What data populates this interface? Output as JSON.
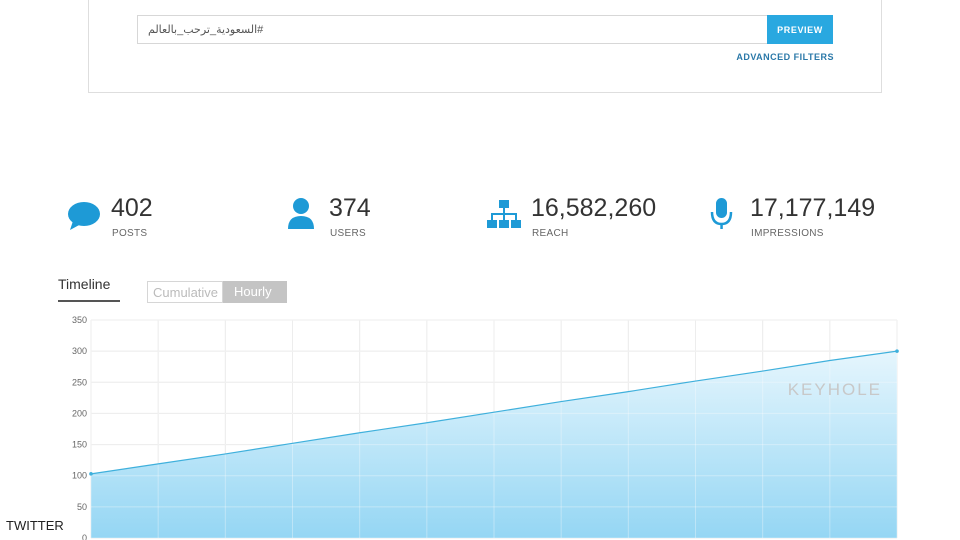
{
  "search": {
    "query": "السعودية_ترحب_بالعالم#",
    "preview_label": "PREVIEW",
    "advanced_filters_label": "ADVANCED FILTERS"
  },
  "stats": [
    {
      "value": "402",
      "label": "POSTS",
      "icon": "chat-bubble-icon"
    },
    {
      "value": "374",
      "label": "USERS",
      "icon": "user-icon"
    },
    {
      "value": "16,582,260",
      "label": "REACH",
      "icon": "org-chart-icon"
    },
    {
      "value": "17,177,149",
      "label": "IMPRESSIONS",
      "icon": "microphone-icon"
    }
  ],
  "timeline": {
    "tab_label": "Timeline",
    "toggle": {
      "cumulative": "Cumulative",
      "hourly": "Hourly",
      "selected": "Hourly"
    }
  },
  "colors": {
    "accent": "#29a8e0",
    "icon": "#1e9ad6",
    "area_top": "#e4f5fd",
    "area_bottom": "#8fd4f3"
  },
  "watermark": "KEYHOLE",
  "source_mark": "TWITTER",
  "chart_data": {
    "type": "area",
    "y_ticks": [
      0,
      50,
      100,
      150,
      200,
      250,
      300,
      350
    ],
    "ylim": [
      0,
      350
    ],
    "x_count": 12,
    "series": [
      {
        "values": [
          103,
          119,
          135,
          152,
          169,
          185,
          202,
          219,
          235,
          252,
          268,
          285,
          300
        ]
      }
    ],
    "grid": true
  }
}
